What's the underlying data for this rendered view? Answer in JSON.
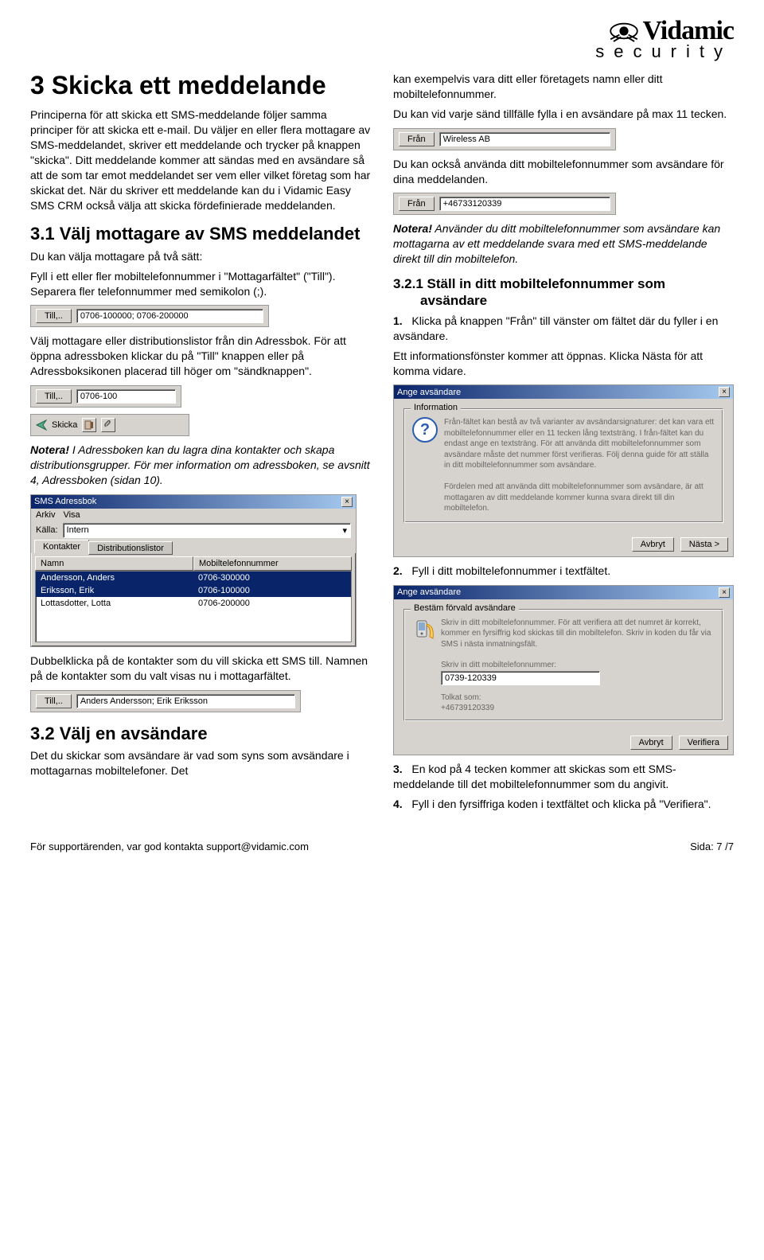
{
  "logo": {
    "brand": "Vidamic",
    "sub": "security"
  },
  "col1": {
    "h1": "3 Skicka ett meddelande",
    "p1": "Principerna för att skicka ett SMS-meddelande följer samma principer för att skicka ett e-mail. Du väljer en eller flera mottagare av SMS-meddelandet, skriver ett meddelande och trycker på knappen \"skicka\". Ditt meddelande kommer att sändas med en avsändare så att de som tar emot meddelandet ser vem eller vilket företag som har skickat det. När du skriver ett meddelande kan du i Vidamic Easy SMS CRM också välja att skicka fördefinierade meddelanden.",
    "h2a": "3.1 Välj mottagare av SMS meddelandet",
    "p2": "Du kan välja mottagare på två sätt:",
    "p3": "Fyll i ett eller fler mobiltelefonnummer i \"Mottagarfältet\" (\"Till\"). Separera fler telefonnummer med semikolon (;).",
    "field1": {
      "btn": "Till,..",
      "value": "0706-100000; 0706-200000"
    },
    "p4": "Välj mottagare eller distributionslistor från din Adressbok. För att öppna adressboken klickar du på \"Till\" knappen eller på Adressboksikonen placerad till höger om \"sändknappen\".",
    "field2": {
      "btn": "Till,..",
      "value": "0706-100"
    },
    "toolbar": {
      "send": "Skicka"
    },
    "note1_b": "Notera!",
    "note1": " I Adressboken kan du lagra dina kontakter och skapa distributionsgrupper. För mer information om adressboken, se avsnitt 4, Adressboken (sidan 10).",
    "adr_win": {
      "title": "SMS Adressbok",
      "menu": [
        "Arkiv",
        "Visa"
      ],
      "src_label": "Källa:",
      "src_value": "Intern",
      "tab1": "Kontakter",
      "tab2": "Distributionslistor",
      "col_name": "Namn",
      "col_phone": "Mobiltelefonnummer",
      "rows": [
        {
          "name": "Andersson, Anders",
          "phone": "0706-300000",
          "sel": true
        },
        {
          "name": "Eriksson, Erik",
          "phone": "0706-100000",
          "sel": true
        },
        {
          "name": "Lottasdotter, Lotta",
          "phone": "0706-200000",
          "sel": false
        }
      ]
    },
    "p5": "Dubbelklicka på de kontakter som du vill skicka ett SMS till. Namnen på de kontakter som du valt visas nu i mottagarfältet.",
    "field3": {
      "btn": "Till,..",
      "value": "Anders Andersson; Erik Eriksson"
    },
    "h2b": "3.2 Välj en avsändare",
    "p6": "Det du skickar som avsändare är vad som syns som avsändare i mottagarnas mobiltelefoner. Det"
  },
  "col2": {
    "p1": "kan exempelvis vara ditt eller företagets namn eller ditt mobiltelefonnummer.",
    "p2": "Du kan vid varje sänd tillfälle fylla i en avsändare på max 11 tecken.",
    "field1": {
      "label": "Från",
      "value": "Wireless AB"
    },
    "p3": "Du kan också använda ditt mobiltelefonnummer som avsändare för dina meddelanden.",
    "field2": {
      "label": "Från",
      "value": "+46733120339"
    },
    "note_b": "Notera!",
    "note": " Använder du ditt mobiltelefonnummer som avsändare kan mottagarna av ett meddelande svara med ett SMS-meddelande direkt till din mobiltelefon.",
    "h3": "3.2.1 Ställ in ditt mobiltelefonnummer som avsändare",
    "s1_n": "1.",
    "s1": "Klicka på knappen \"Från\" till vänster om fältet där du fyller i en avsändare.",
    "p4": "Ett informationsfönster kommer att öppnas. Klicka Nästa för att komma vidare.",
    "dlg1": {
      "title": "Ange avsändare",
      "group": "Information",
      "text": "Från-fältet kan bestå av två varianter av avsändarsignaturer: det kan vara ett mobiltelefonnummer eller en 11 tecken lång textsträng. I från-fältet kan du endast ange en textsträng. För att använda ditt mobiltelefonnummer som avsändare måste det nummer först verifieras. Följ denna guide för att ställa in ditt mobiltelefonnummer som avsändare.\n\nFördelen med att använda ditt mobiltelefonnummer som avsändare, är att mottagaren av ditt meddelande kommer kunna svara direkt till din mobiltelefon.",
      "btn_cancel": "Avbryt",
      "btn_next": "Nästa >"
    },
    "s2_n": "2.",
    "s2": "Fyll i ditt mobiltelefonnummer i textfältet.",
    "dlg2": {
      "title": "Ange avsändare",
      "group": "Bestäm förvald avsändare",
      "text": "Skriv in ditt mobiltelefonnummer. För att verifiera att det numret är korrekt, kommer en fyrsiffrig kod skickas till din mobiltelefon. Skriv in koden du får via SMS i nästa inmatningsfält.",
      "label1": "Skriv in ditt mobiltelefonnummer:",
      "input": "0739-120339",
      "label2": "Tolkat som:",
      "tolk": "+46739120339",
      "btn_cancel": "Avbryt",
      "btn_verify": "Verifiera"
    },
    "s3_n": "3.",
    "s3": "En kod på 4 tecken kommer att skickas som ett SMS-meddelande till det mobiltelefonnummer som du angivit.",
    "s4_n": "4.",
    "s4": "Fyll i den fyrsiffriga koden i textfältet och klicka på \"Verifiera\"."
  },
  "footer": {
    "support": "För supportärenden, var god kontakta support@vidamic.com",
    "page": "Sida: 7 /7"
  }
}
